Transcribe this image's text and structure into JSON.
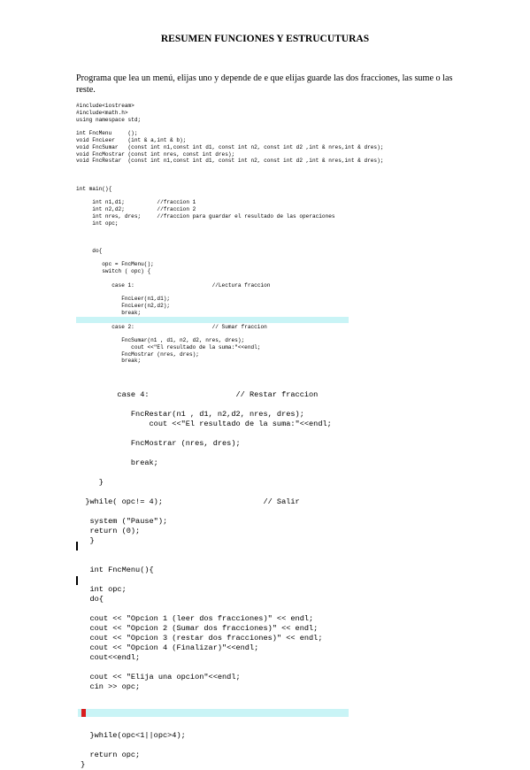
{
  "title": "RESUMEN FUNCIONES Y ESTRUCUTURAS",
  "intro": "Programa que lea un menú, elijas uno y depende de e que elijas guarde las dos fracciones, las sume o las reste.",
  "code_top": [
    "#include<iostream>",
    "#include<math.h>",
    "using namespace std;",
    "",
    "int FncMenu     ();",
    "void FncLeer    (int & a,int & b);",
    "void FncSumar   (const int n1,const int d1, const int n2, const int d2 ,int & nres,int & dres);",
    "void FncMostrar (const int nres, const int dres);",
    "void FncRestar  (const int n1,const int d1, const int n2, const int d2 ,int & nres,int & dres);",
    "",
    "",
    "",
    "int main(){",
    "",
    "     int n1,d1;          //fraccion 1",
    "     int n2,d2;          //fraccion 2",
    "     int nres, dres;     //fraccion para guardar el resultado de las operaciones",
    "     int opc;",
    "",
    "",
    "",
    "     do{",
    "",
    "        opc = FncMenu();",
    "        switch ( opc) {",
    "",
    "           case 1:                        //Lectura fraccion",
    "",
    "              FncLeer(n1,d1);",
    "              FncLeer(n2,d2);",
    "              break;",
    "",
    "           case 2:                        // Sumar fraccion",
    "",
    "              FncSumar(n1 , d1, n2, d2, nres, dres);",
    "                 cout <<\"El resultado de la suma:\"<<endl;",
    "              FncMostrar (nres, dres);",
    "              break;"
  ],
  "code_bottom": [
    "         case 4:                   // Restar fraccion",
    "",
    "            FncRestar(n1 , d1, n2,d2, nres, dres);",
    "                cout <<\"El resultado de la suma:\"<<endl;",
    "",
    "            FncMostrar (nres, dres);",
    "",
    "            break;",
    "",
    "     }",
    "",
    "  }while( opc!= 4);                      // Salir",
    "",
    "   system (\"Pause\");",
    "   return (0);",
    "   }",
    "",
    "",
    "   int FncMenu(){",
    "",
    "   int opc;",
    "   do{",
    "",
    "   cout << \"Opcion 1 (leer dos fracciones)\" << endl;",
    "   cout << \"Opcion 2 (Sumar dos fracciones)\" << endl;",
    "   cout << \"Opcion 3 (restar dos fracciones)\" << endl;",
    "   cout << \"Opcion 4 (Finalizar)\"<<endl;",
    "   cout<<endl;",
    "",
    "   cout << \"Elija una opcion\"<<endl;",
    "   cin >> opc;",
    "",
    "",
    "",
    "",
    "   }while(opc<1||opc>4);",
    "",
    "   return opc;",
    " }"
  ],
  "colors": {
    "highlight": "#c9f4f6",
    "comment": "#2f7f2f",
    "marker": "#d81e1e"
  }
}
